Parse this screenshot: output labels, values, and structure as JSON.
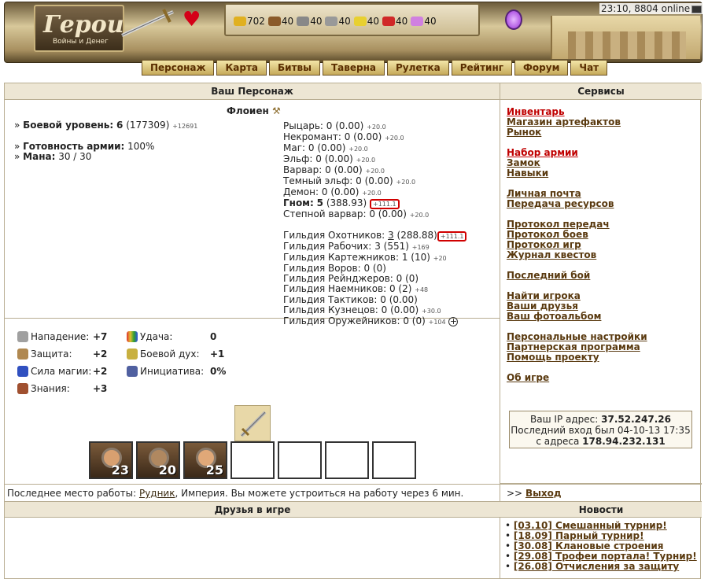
{
  "header": {
    "logo_title": "Герои",
    "logo_subtitle": "Войны и Денег",
    "time_online": "23:10, 8804 online",
    "resources": [
      {
        "name": "gold",
        "value": "702",
        "color": "#e0b020"
      },
      {
        "name": "wood",
        "value": "40",
        "color": "#8a5a2a"
      },
      {
        "name": "ore",
        "value": "40",
        "color": "#888888"
      },
      {
        "name": "mercury",
        "value": "40",
        "color": "#999999"
      },
      {
        "name": "sulfur",
        "value": "40",
        "color": "#e8d030"
      },
      {
        "name": "crystals",
        "value": "40",
        "color": "#d02828"
      },
      {
        "name": "gems",
        "value": "40",
        "color": "#d080e0"
      }
    ],
    "nav": [
      "Персонаж",
      "Карта",
      "Битвы",
      "Таверна",
      "Рулетка",
      "Рейтинг",
      "Форум",
      "Чат"
    ]
  },
  "character": {
    "section_title": "Ваш Персонаж",
    "name": "Флоиен",
    "combat_level_label": "Боевой уровень:",
    "combat_level": "6",
    "combat_exp": "(177309)",
    "combat_exp_delta": "+12691",
    "army_ready_label": "Готовность армии:",
    "army_ready": "100%",
    "mana_label": "Мана:",
    "mana": "30 / 30",
    "factions": [
      {
        "label": "Рыцарь:",
        "value": "0 (0.00)",
        "delta": "+20.0"
      },
      {
        "label": "Некромант:",
        "value": "0 (0.00)",
        "delta": "+20.0"
      },
      {
        "label": "Маг:",
        "value": "0 (0.00)",
        "delta": "+20.0"
      },
      {
        "label": "Эльф:",
        "value": "0 (0.00)",
        "delta": "+20.0"
      },
      {
        "label": "Варвар:",
        "value": "0 (0.00)",
        "delta": "+20.0"
      },
      {
        "label": "Темный эльф:",
        "value": "0 (0.00)",
        "delta": "+20.0"
      },
      {
        "label": "Демон:",
        "value": "0 (0.00)",
        "delta": "+20.0"
      }
    ],
    "gnome": {
      "label": "Гном:",
      "value": "5",
      "points": "(388.93)",
      "delta": "+111.1"
    },
    "steppe": {
      "label": "Степной варвар:",
      "value": "0 (0.00)",
      "delta": "+20.0"
    },
    "guilds": [
      {
        "label": "Гильдия Охотников:",
        "value": "3",
        "points": "(288.88)",
        "delta": "+111.1"
      },
      {
        "label": "Гильдия Рабочих:",
        "value": "3 (551)",
        "delta": "+169"
      },
      {
        "label": "Гильдия Картежников:",
        "value": "1 (10)",
        "delta": "+20"
      },
      {
        "label": "Гильдия Воров:",
        "value": "0 (0)",
        "delta": ""
      },
      {
        "label": "Гильдия Рейнджеров:",
        "value": "0 (0)",
        "delta": ""
      },
      {
        "label": "Гильдия Наемников:",
        "value": "0 (2)",
        "delta": "+48"
      },
      {
        "label": "Гильдия Тактиков:",
        "value": "0 (0.00)",
        "delta": ""
      },
      {
        "label": "Гильдия Кузнецов:",
        "value": "0 (0.00)",
        "delta": "+30.0"
      },
      {
        "label": "Гильдия Оружейников:",
        "value": "0 (0)",
        "delta": "+104"
      }
    ],
    "plus": "+"
  },
  "attributes": {
    "attack": {
      "label": "Нападение:",
      "value": "+7"
    },
    "defense": {
      "label": "Защита:",
      "value": "+2"
    },
    "magic": {
      "label": "Сила магии:",
      "value": "+2"
    },
    "knowledge": {
      "label": "Знания:",
      "value": "+3"
    },
    "luck": {
      "label": "Удача:",
      "value": "0"
    },
    "morale": {
      "label": "Боевой дух:",
      "value": "+1"
    },
    "initiative": {
      "label": "Инициатива:",
      "value": "0%"
    }
  },
  "army": [
    "23",
    "20",
    "25"
  ],
  "work": {
    "prefix": "Последнее место работы: ",
    "place": "Рудник",
    "suffix": ", Империя. Вы можете устроиться на работу через 6 мин."
  },
  "friends_title": "Друзья в игре",
  "services": {
    "title": "Сервисы",
    "groups": [
      [
        {
          "label": "Инвентарь",
          "red": true
        },
        {
          "label": "Магазин артефактов"
        },
        {
          "label": "Рынок"
        }
      ],
      [
        {
          "label": "Набор армии",
          "red": true
        },
        {
          "label": "Замок"
        },
        {
          "label": "Навыки"
        }
      ],
      [
        {
          "label": "Личная почта"
        },
        {
          "label": "Передача ресурсов"
        }
      ],
      [
        {
          "label": "Протокол передач"
        },
        {
          "label": "Протокол боев"
        },
        {
          "label": "Протокол игр"
        },
        {
          "label": "Журнал квестов"
        }
      ],
      [
        {
          "label": "Последний бой"
        }
      ],
      [
        {
          "label": "Найти игрока"
        },
        {
          "label": "Ваши друзья"
        },
        {
          "label": "Ваш фотоальбом"
        }
      ],
      [
        {
          "label": "Персональные настройки"
        },
        {
          "label": "Партнерская программа"
        },
        {
          "label": "Помощь проекту"
        }
      ],
      [
        {
          "label": "Об игре"
        }
      ]
    ]
  },
  "ip": {
    "ip_label": "Ваш IP адрес: ",
    "ip": "37.52.247.26",
    "last_login": "Последний вход был 04-10-13 17:35",
    "from_label": "с адреса ",
    "from_ip": "178.94.232.131"
  },
  "logout": {
    "prefix": ">> ",
    "label": "Выход"
  },
  "news": {
    "title": "Новости",
    "items": [
      "[03.10] Смешанный турнир!",
      "[18.09] Парный турнир!",
      "[30.08] Клановые строения",
      "[29.08] Трофеи портала! Турнир!",
      "[26.08] Отчисления за защиту"
    ]
  }
}
